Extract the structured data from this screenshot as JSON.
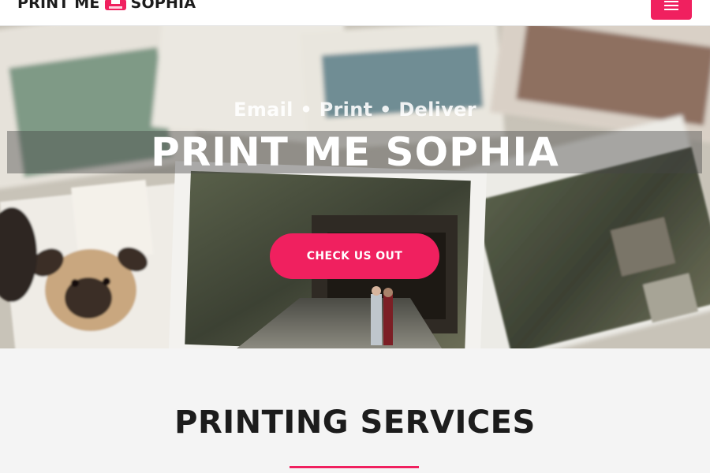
{
  "header": {
    "logo_left": "PRINT ME",
    "logo_right": "SOPHIA",
    "logo_icon": "printer-icon",
    "menu_icon": "hamburger-menu-icon"
  },
  "hero": {
    "tagline": "Email • Print • Deliver",
    "title": "PRINT ME SOPHIA",
    "cta_label": "CHECK US OUT"
  },
  "services": {
    "title": "PRINTING SERVICES"
  },
  "colors": {
    "accent": "#f0205f",
    "heading": "#1c1c1c",
    "section_bg": "#f4f4f4",
    "header_bg": "#ffffff"
  }
}
